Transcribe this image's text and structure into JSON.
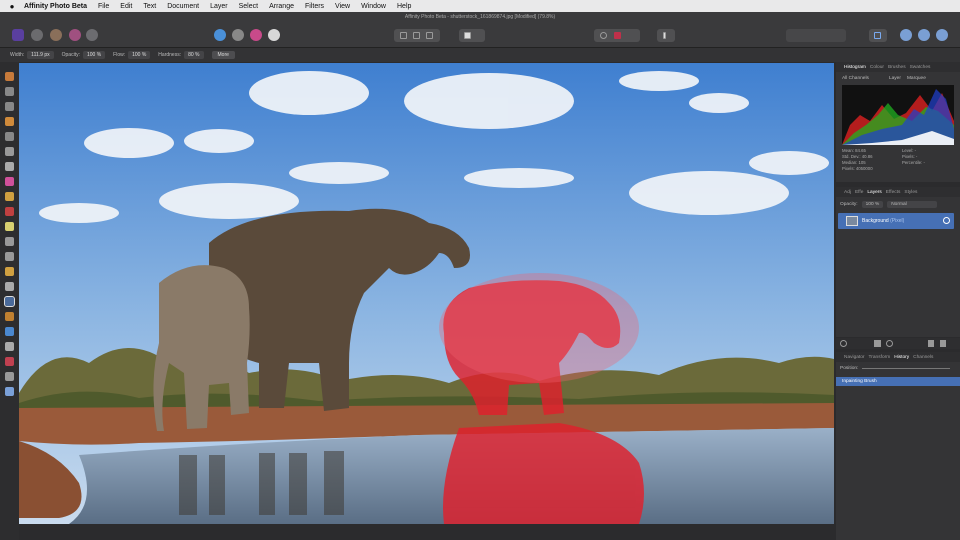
{
  "menubar": {
    "app_name": "Affinity Photo Beta",
    "items": [
      "File",
      "Edit",
      "Text",
      "Document",
      "Layer",
      "Select",
      "Arrange",
      "Filters",
      "View",
      "Window",
      "Help"
    ]
  },
  "window": {
    "title": "Affinity Photo Beta - shutterstock_161869874.jpg [Modified] (79.8%)"
  },
  "context_bar": {
    "width_label": "Width:",
    "width_value": "111.9 px",
    "opacity_label": "Opacity:",
    "opacity_value": "100 %",
    "flow_label": "Flow:",
    "flow_value": "100 %",
    "hardness_label": "Hardness:",
    "hardness_value": "80 %",
    "more_label": "More"
  },
  "top_panel": {
    "tabs": [
      "Histogram",
      "Colour",
      "Brushes",
      "Swatches"
    ],
    "active_tab": "Histogram",
    "channel_select": "All Channels",
    "layer_option": "Layer",
    "marquee_option": "Marquee",
    "stats_left": [
      "Mean: 84.65",
      "Std. Dev.: 40.86",
      "Median: 105",
      "Pixels: 4050000"
    ],
    "stats_right": [
      "Level: -",
      "Pixels: -",
      "Percentile: -"
    ]
  },
  "layers_panel": {
    "tabs": [
      "Adj",
      "Effe",
      "Layers",
      "Effects",
      "Styles"
    ],
    "active_tab": "Layers",
    "opacity_label": "Opacity:",
    "opacity_value": "100 %",
    "blend_mode": "Normal",
    "layer_name": "Background",
    "layer_type": "(Pixel)"
  },
  "history_panel": {
    "tabs": [
      "Navigator",
      "Transform",
      "History",
      "Channels"
    ],
    "active_tab": "History",
    "position_label": "Position:",
    "entry": "Inpainting Brush"
  },
  "colors": {
    "accent": "#4670b5",
    "menubar_bg": "#e9e9ea",
    "toolbar_bg": "#3a3a3c",
    "panel_bg": "#343436",
    "inpaint_red": "#e0202c"
  }
}
